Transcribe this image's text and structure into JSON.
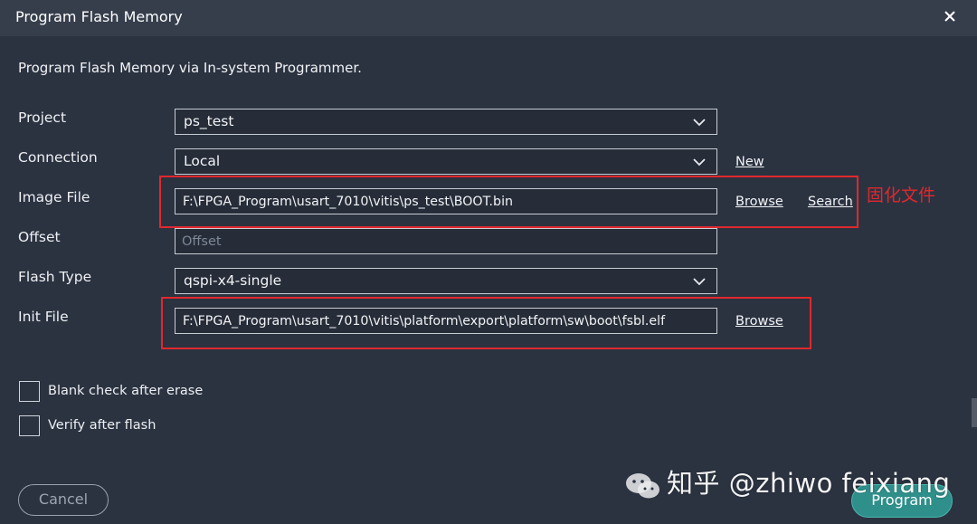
{
  "window": {
    "title": "Program Flash Memory",
    "close_icon": "close-icon"
  },
  "description": "Program Flash Memory via In-system Programmer.",
  "form": {
    "project": {
      "label": "Project",
      "value": "ps_test"
    },
    "connection": {
      "label": "Connection",
      "value": "Local",
      "new_link": "New"
    },
    "image_file": {
      "label": "Image File",
      "value": "F:\\FPGA_Program\\usart_7010\\vitis\\ps_test\\BOOT.bin",
      "browse_link": "Browse",
      "search_link": "Search"
    },
    "offset": {
      "label": "Offset",
      "value": "",
      "placeholder": "Offset"
    },
    "flash_type": {
      "label": "Flash Type",
      "value": "qspi-x4-single"
    },
    "init_file": {
      "label": "Init File",
      "value": "F:\\FPGA_Program\\usart_7010\\vitis\\platform\\export\\platform\\sw\\boot\\fsbl.elf",
      "browse_link": "Browse"
    }
  },
  "options": {
    "blank_check": {
      "label": "Blank check after erase",
      "checked": false
    },
    "verify": {
      "label": "Verify after flash",
      "checked": false
    }
  },
  "annotation": {
    "text": "固化文件",
    "color": "#e0282d"
  },
  "buttons": {
    "cancel": "Cancel",
    "program": "Program"
  },
  "watermark": {
    "text": "知乎 @zhiwo feixiang"
  },
  "colors": {
    "background": "#2b3341",
    "titlebar": "#363e4c",
    "accent": "#2f8f8a",
    "highlight": "#e0282d"
  }
}
